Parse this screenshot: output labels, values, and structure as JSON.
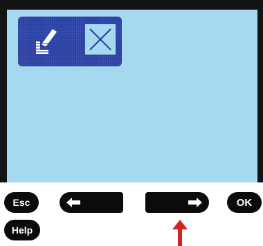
{
  "screen": {
    "background_color": "#a6d8ef",
    "icon_panel": {
      "background_color": "#283fa4",
      "icons": [
        "arrow-down-left-icon",
        "cancel-x-icon"
      ]
    }
  },
  "softkeys": {
    "esc_label": "Esc",
    "help_label": "Help",
    "ok_label": "OK",
    "left_arrow_icon": "arrow-left-icon",
    "right_arrow_icon": "arrow-right-icon"
  },
  "annotation": {
    "pointer_color": "#d62222",
    "pointer_icon": "arrow-up-icon"
  }
}
